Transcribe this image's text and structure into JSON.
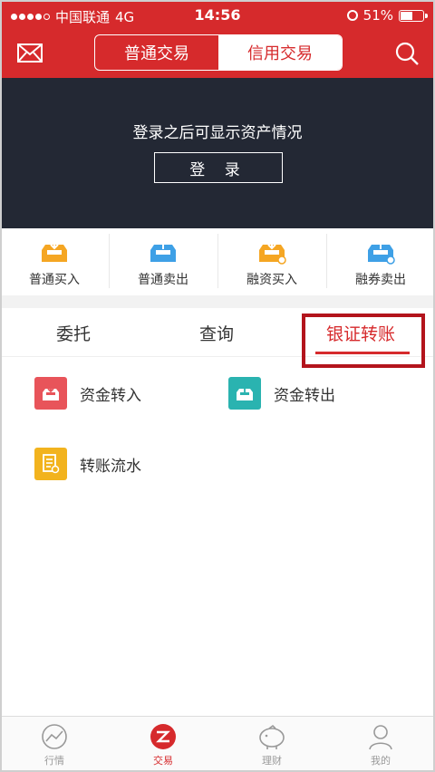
{
  "status_bar": {
    "carrier": "中国联通",
    "network": "4G",
    "time": "14:56",
    "battery": "51%"
  },
  "header": {
    "mail_icon": "mail-icon",
    "search_icon": "search-icon",
    "tabs": [
      {
        "label": "普通交易",
        "active": false
      },
      {
        "label": "信用交易",
        "active": true
      }
    ]
  },
  "banner": {
    "message": "登录之后可显示资产情况",
    "login_label": "登 录"
  },
  "quick_actions": [
    {
      "label": "普通买入",
      "icon": "download-tray-icon",
      "color": "#f5a623"
    },
    {
      "label": "普通卖出",
      "icon": "upload-tray-icon",
      "color": "#3ea0e6"
    },
    {
      "label": "融资买入",
      "icon": "download-tray-icon",
      "color": "#f5a623"
    },
    {
      "label": "融券卖出",
      "icon": "upload-tray-icon",
      "color": "#3ea0e6"
    }
  ],
  "sub_tabs": [
    {
      "label": "委托",
      "active": false
    },
    {
      "label": "查询",
      "active": false
    },
    {
      "label": "银证转账",
      "active": true
    }
  ],
  "fund_items": [
    {
      "label": "资金转入",
      "icon": "transfer-in-icon",
      "color": "#e8545a"
    },
    {
      "label": "资金转出",
      "icon": "transfer-out-icon",
      "color": "#2ab3b0"
    },
    {
      "label": "转账流水",
      "icon": "document-list-icon",
      "color": "#f2b31e"
    }
  ],
  "bottom_tabs": [
    {
      "label": "行情",
      "icon": "chart-icon",
      "active": false
    },
    {
      "label": "交易",
      "icon": "trade-icon",
      "active": true
    },
    {
      "label": "理财",
      "icon": "piggy-bank-icon",
      "active": false
    },
    {
      "label": "我的",
      "icon": "person-icon",
      "active": false
    }
  ],
  "colors": {
    "brand_red": "#d62a2c",
    "banner_dark": "#232834",
    "highlight_border": "#b3141c"
  }
}
